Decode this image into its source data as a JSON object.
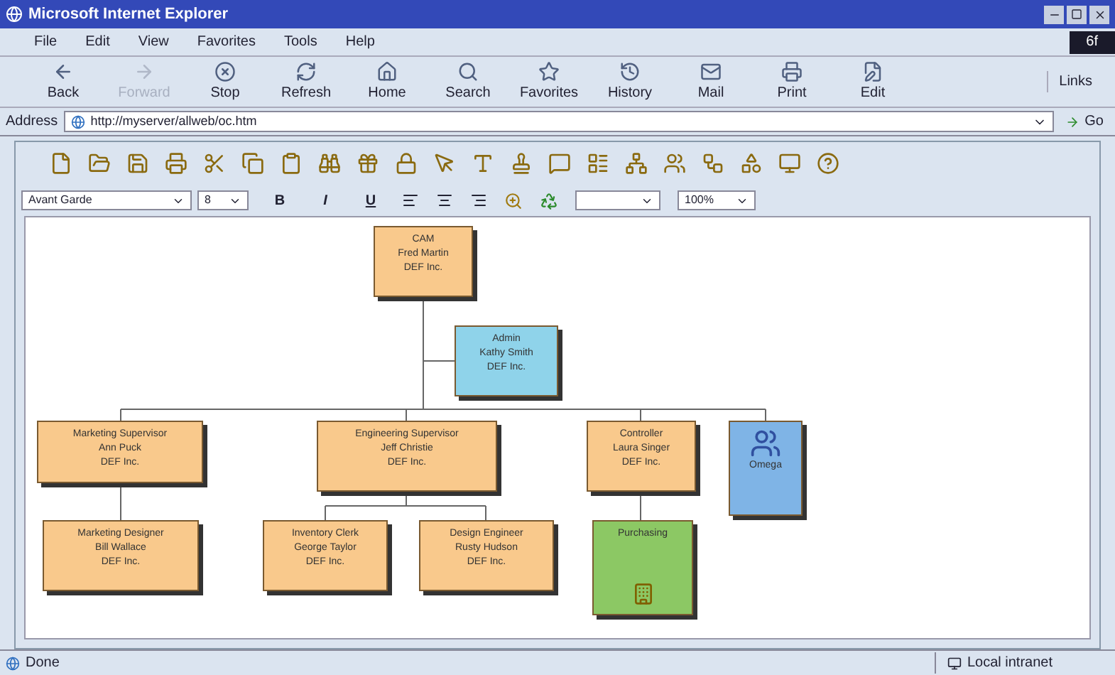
{
  "window": {
    "title": "Microsoft Internet Explorer"
  },
  "badge": "6f",
  "menu": [
    "File",
    "Edit",
    "View",
    "Favorites",
    "Tools",
    "Help"
  ],
  "nav_buttons": [
    {
      "label": "Back",
      "disabled": false
    },
    {
      "label": "Forward",
      "disabled": true
    },
    {
      "label": "Stop",
      "disabled": false
    },
    {
      "label": "Refresh",
      "disabled": false
    },
    {
      "label": "Home",
      "disabled": false
    },
    {
      "label": "Search",
      "disabled": false
    },
    {
      "label": "Favorites",
      "disabled": false
    },
    {
      "label": "History",
      "disabled": false
    },
    {
      "label": "Mail",
      "disabled": false
    },
    {
      "label": "Print",
      "disabled": false
    },
    {
      "label": "Edit",
      "disabled": false
    }
  ],
  "links": "Links",
  "address": {
    "label": "Address",
    "url": "http://myserver/allweb/oc.htm",
    "go": "Go"
  },
  "format_bar": {
    "font": "Avant Garde",
    "size": "8",
    "buttons": [
      "B",
      "I",
      "U"
    ],
    "zoom": "100%"
  },
  "org_chart": {
    "kind": "person",
    "color": "#f9c98c",
    "lines": [
      "CAM",
      "Fred Martin",
      "DEF Inc."
    ],
    "children": [
      {
        "kind": "person",
        "color": "#8fd3ea",
        "lines": [
          "Admin",
          "Kathy Smith",
          "DEF Inc."
        ]
      },
      {
        "kind": "person",
        "color": "#f9c98c",
        "lines": [
          "Marketing Supervisor",
          "Ann Puck",
          "DEF Inc."
        ],
        "children": [
          {
            "kind": "person",
            "color": "#f9c98c",
            "lines": [
              "Marketing Designer",
              "Bill Wallace",
              "DEF Inc."
            ]
          }
        ]
      },
      {
        "kind": "person",
        "color": "#f9c98c",
        "lines": [
          "Engineering Supervisor",
          "Jeff Christie",
          "DEF Inc."
        ],
        "children": [
          {
            "kind": "person",
            "color": "#f9c98c",
            "lines": [
              "Inventory Clerk",
              "George Taylor",
              "DEF Inc."
            ]
          },
          {
            "kind": "person",
            "color": "#f9c98c",
            "lines": [
              "Design Engineer",
              "Rusty Hudson",
              "DEF Inc."
            ]
          }
        ]
      },
      {
        "kind": "person",
        "color": "#f9c98c",
        "lines": [
          "Controller",
          "Laura Singer",
          "DEF Inc."
        ],
        "children": [
          {
            "kind": "department",
            "color": "#8cc864",
            "lines": [
              "Purchasing"
            ]
          }
        ]
      },
      {
        "kind": "unit",
        "color": "#7fb4e6",
        "lines": [
          "Omega"
        ]
      }
    ]
  },
  "status_bar": {
    "text": "Done",
    "zone": "Local intranet"
  }
}
